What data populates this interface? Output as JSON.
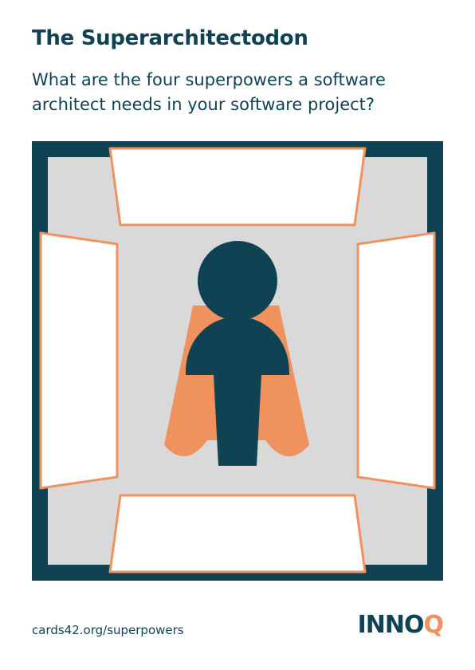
{
  "card": {
    "title": "The Superarchitectodon",
    "question": "What are the four superpowers a software architect needs in your software project?",
    "url": "cards42.org/superpowers"
  },
  "logo": {
    "main": "INNO",
    "accent": "Q"
  },
  "colors": {
    "navy": "#0f4354",
    "orange": "#f0925e",
    "panel_grey": "#d9d9d9",
    "card_white": "#ffffff"
  },
  "illustration": {
    "subject": "architect figure with cape",
    "empty_cards": [
      "top",
      "left",
      "right",
      "bottom"
    ]
  }
}
